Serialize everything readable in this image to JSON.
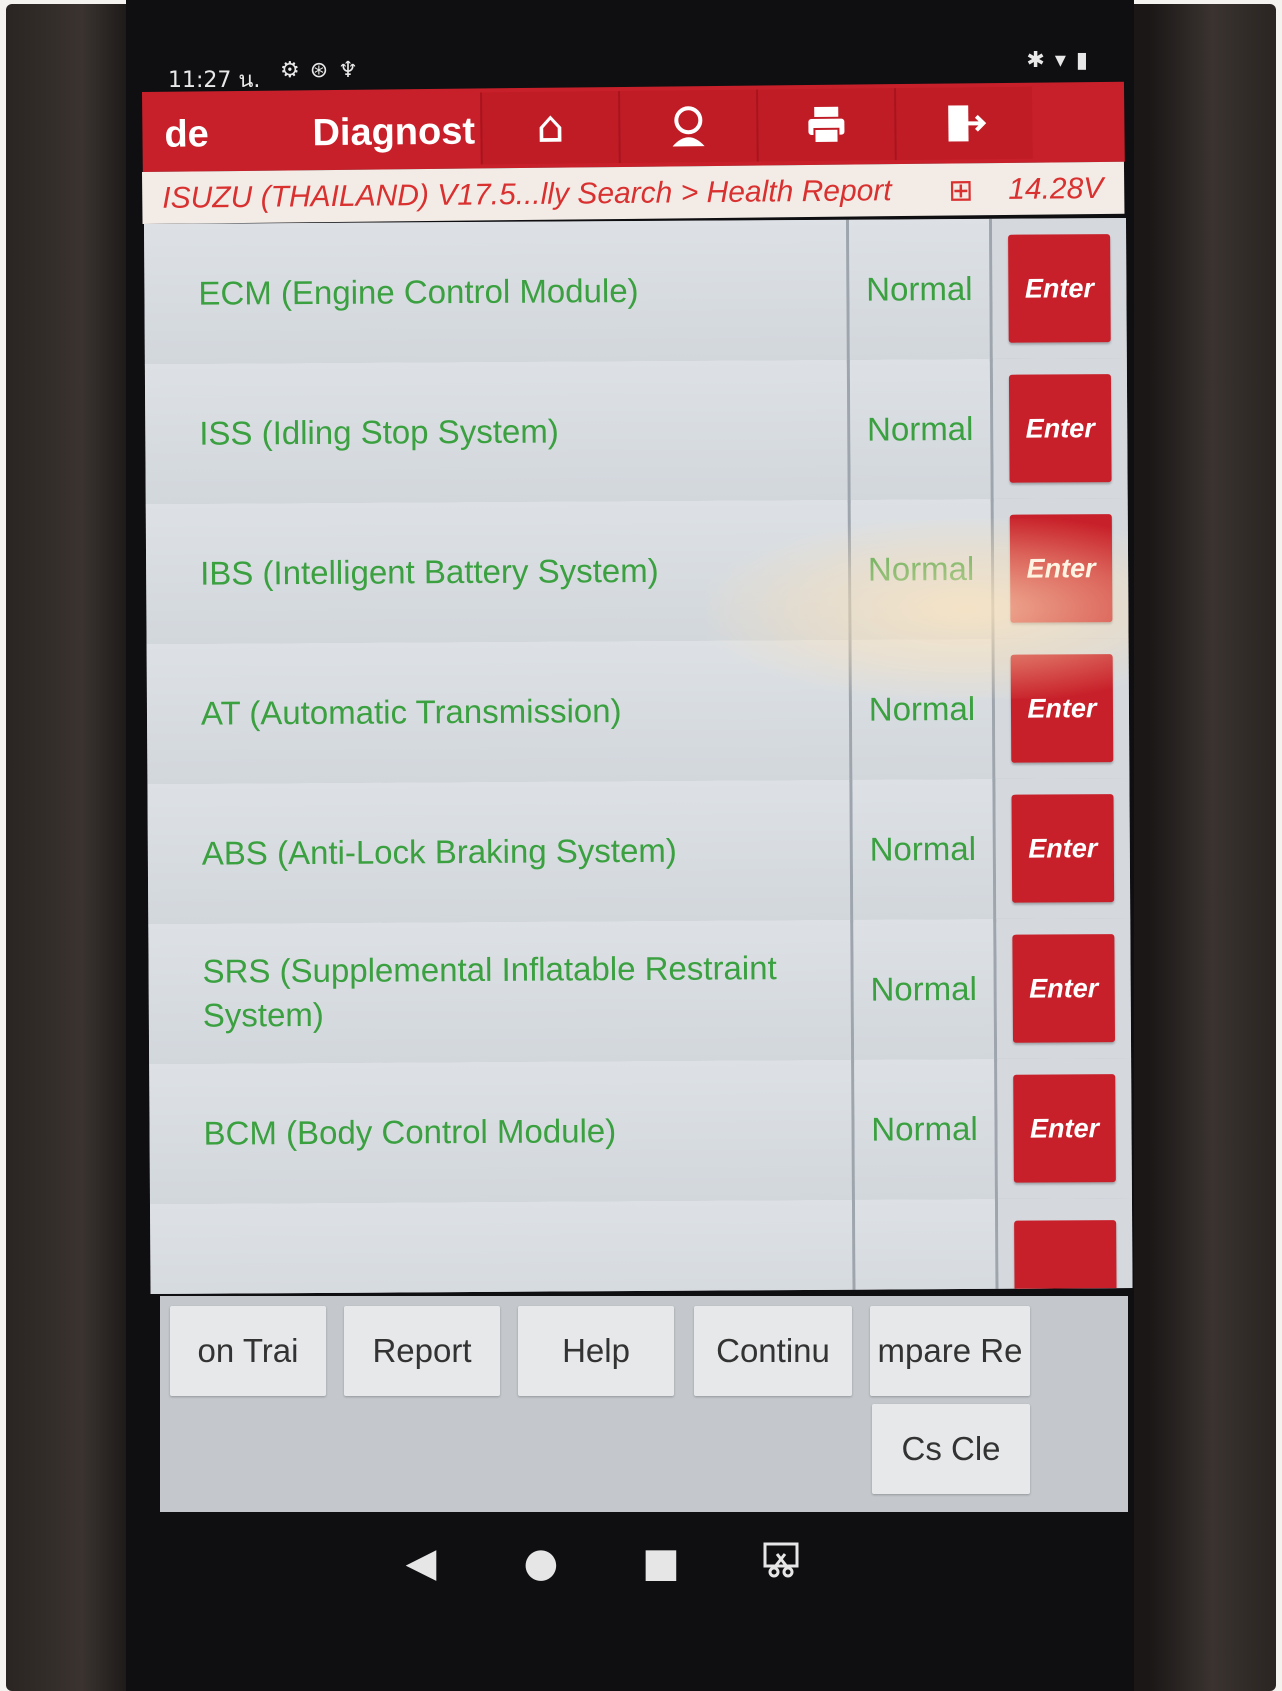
{
  "status_bar": {
    "time": "11:27 น.",
    "left_icons": [
      "gear-icon",
      "bluetooth-circle-icon",
      "stethoscope-icon"
    ],
    "right_icons": [
      "bluetooth-icon",
      "wifi-icon",
      "battery-icon"
    ]
  },
  "header": {
    "brand": "de",
    "title": "Diagnost",
    "buttons": [
      "home-icon",
      "support-icon",
      "print-icon",
      "exit-icon"
    ],
    "accent": "#c8202a"
  },
  "breadcrumb": {
    "path": "ISUZU (THAILAND) V17.5...lly Search > Health Report",
    "voltage": "14.28V"
  },
  "modules": [
    {
      "name": "ECM (Engine Control Module)",
      "status": "Normal",
      "action": "Enter"
    },
    {
      "name": "ISS (Idling Stop System)",
      "status": "Normal",
      "action": "Enter"
    },
    {
      "name": "IBS (Intelligent Battery System)",
      "status": "Normal",
      "action": "Enter"
    },
    {
      "name": "AT (Automatic Transmission)",
      "status": "Normal",
      "action": "Enter"
    },
    {
      "name": "ABS (Anti-Lock Braking System)",
      "status": "Normal",
      "action": "Enter"
    },
    {
      "name": "SRS (Supplemental Inflatable Restraint System)",
      "status": "Normal",
      "action": "Enter"
    },
    {
      "name": "BCM (Body Control Module)",
      "status": "Normal",
      "action": "Enter"
    }
  ],
  "toolbar": {
    "row1": [
      "on   Trai",
      "Report",
      "Help",
      "Continu",
      "mpare Re"
    ],
    "row2": [
      "Cs    Cle"
    ]
  },
  "colors": {
    "status_normal": "#3aa040",
    "enter_button": "#c8202a"
  }
}
